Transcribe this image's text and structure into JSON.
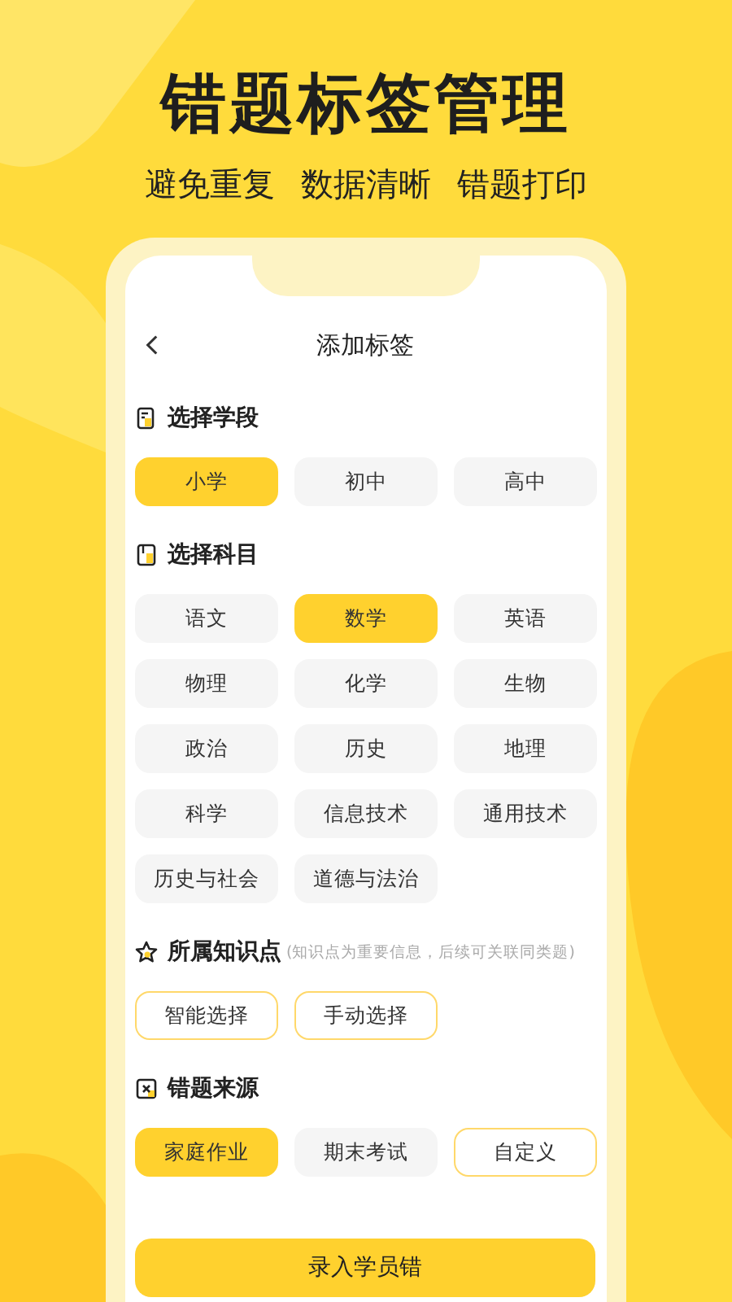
{
  "title": "错题标签管理",
  "subtitle": [
    "避免重复",
    "数据清晰",
    "错题打印"
  ],
  "screen": {
    "title": "添加标签",
    "sections": [
      {
        "heading": "选择学段",
        "chips": [
          {
            "label": "小学",
            "kind": "option",
            "selected": true
          },
          {
            "label": "初中",
            "kind": "option",
            "selected": false
          },
          {
            "label": "高中",
            "kind": "option",
            "selected": false
          }
        ]
      },
      {
        "heading": "选择科目",
        "chips": [
          {
            "label": "语文",
            "kind": "option",
            "selected": false
          },
          {
            "label": "数学",
            "kind": "option",
            "selected": true
          },
          {
            "label": "英语",
            "kind": "option",
            "selected": false
          },
          {
            "label": "物理",
            "kind": "option",
            "selected": false
          },
          {
            "label": "化学",
            "kind": "option",
            "selected": false
          },
          {
            "label": "生物",
            "kind": "option",
            "selected": false
          },
          {
            "label": "政治",
            "kind": "option",
            "selected": false
          },
          {
            "label": "历史",
            "kind": "option",
            "selected": false
          },
          {
            "label": "地理",
            "kind": "option",
            "selected": false
          },
          {
            "label": "科学",
            "kind": "option",
            "selected": false
          },
          {
            "label": "信息技术",
            "kind": "option",
            "selected": false
          },
          {
            "label": "通用技术",
            "kind": "option",
            "selected": false
          },
          {
            "label": "历史与社会",
            "kind": "option",
            "selected": false
          },
          {
            "label": "道德与法治",
            "kind": "option",
            "selected": false
          }
        ]
      },
      {
        "heading": "所属知识点",
        "hint": "(知识点为重要信息，后续可关联同类题)",
        "chips": [
          {
            "label": "智能选择",
            "kind": "action",
            "selected": false
          },
          {
            "label": "手动选择",
            "kind": "action",
            "selected": false
          }
        ]
      },
      {
        "heading": "错题来源",
        "chips": [
          {
            "label": "家庭作业",
            "kind": "option",
            "selected": true
          },
          {
            "label": "期末考试",
            "kind": "option",
            "selected": false
          },
          {
            "label": "自定义",
            "kind": "action",
            "selected": false
          }
        ]
      }
    ],
    "submit": "录入学员错"
  }
}
